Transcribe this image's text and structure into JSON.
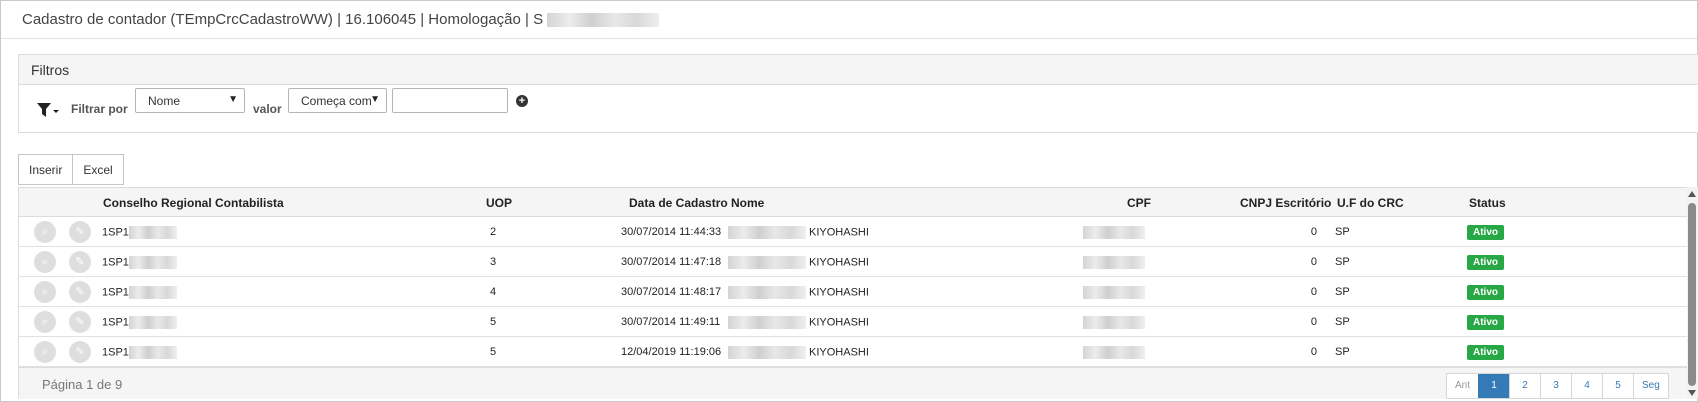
{
  "header": {
    "title": "Cadastro de contador (TEmpCrcCadastroWW) | 16.106045 | Homologação | S"
  },
  "filters": {
    "title": "Filtros",
    "filter_by_label": "Filtrar por",
    "filter_by_value": "Nome",
    "value_label": "valor",
    "operator_value": "Começa com",
    "value_input": ""
  },
  "toolbar": {
    "insert_label": "Inserir",
    "excel_label": "Excel"
  },
  "grid": {
    "columns": {
      "crc": "Conselho Regional Contabilista",
      "uop": "UOP",
      "date": "Data de Cadastro",
      "name": "Nome",
      "cpf": "CPF",
      "cnpj": "CNPJ Escritório",
      "uf": "U.F do CRC",
      "status": "Status"
    },
    "rows": [
      {
        "crc": "1SP1",
        "uop": "2",
        "date": "30/07/2014 11:44:33",
        "name": "KIYOHASHI",
        "cnpj": "0",
        "uf": "SP",
        "status": "Ativo"
      },
      {
        "crc": "1SP1",
        "uop": "3",
        "date": "30/07/2014 11:47:18",
        "name": "KIYOHASHI",
        "cnpj": "0",
        "uf": "SP",
        "status": "Ativo"
      },
      {
        "crc": "1SP1",
        "uop": "4",
        "date": "30/07/2014 11:48:17",
        "name": "KIYOHASHI",
        "cnpj": "0",
        "uf": "SP",
        "status": "Ativo"
      },
      {
        "crc": "1SP1",
        "uop": "5",
        "date": "30/07/2014 11:49:11",
        "name": "KIYOHASHI",
        "cnpj": "0",
        "uf": "SP",
        "status": "Ativo"
      },
      {
        "crc": "1SP1",
        "uop": "5",
        "date": "12/04/2019 11:19:06",
        "name": "KIYOHASHI",
        "cnpj": "0",
        "uf": "SP",
        "status": "Ativo"
      }
    ],
    "status_color": "#28a745"
  },
  "pagination": {
    "info": "Página 1 de 9",
    "prev": "Ant",
    "pages": [
      "1",
      "2",
      "3",
      "4",
      "5"
    ],
    "next": "Seg",
    "active_color": "#337ab7"
  },
  "icons": {
    "row_view": "search-icon",
    "row_edit": "pencil-icon",
    "filter": "funnel-icon",
    "add_filter": "plus-circle-icon"
  }
}
